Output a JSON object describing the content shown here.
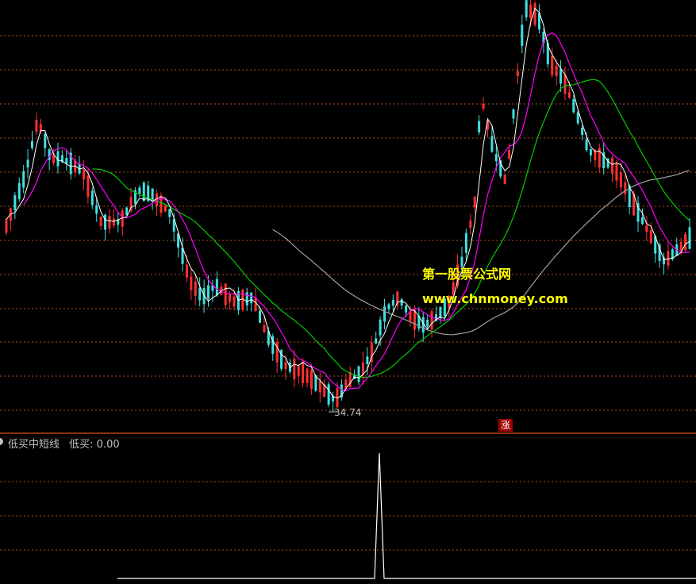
{
  "watermark": {
    "title": "第一股票公式网",
    "url": "www.chnmoney.com"
  },
  "indicator": {
    "name": "低买中短线",
    "label": "低买: 0.00"
  },
  "low_price_label": "34.74",
  "badge": "涨",
  "colors": {
    "background": "#000000",
    "grid": "#b05020",
    "separator": "#c04000",
    "up": "#ff3030",
    "down": "#40e0e0",
    "ma_white": "#ffffff",
    "ma_magenta": "#ff00ff",
    "ma_green": "#00cc00",
    "ma_gray": "#a0a0a0",
    "indicator_line": "#ffffff"
  },
  "chart_data": {
    "type": "candlestick",
    "candle_count": 160,
    "low_point": 34.74,
    "indicator_spike_index": 88
  }
}
